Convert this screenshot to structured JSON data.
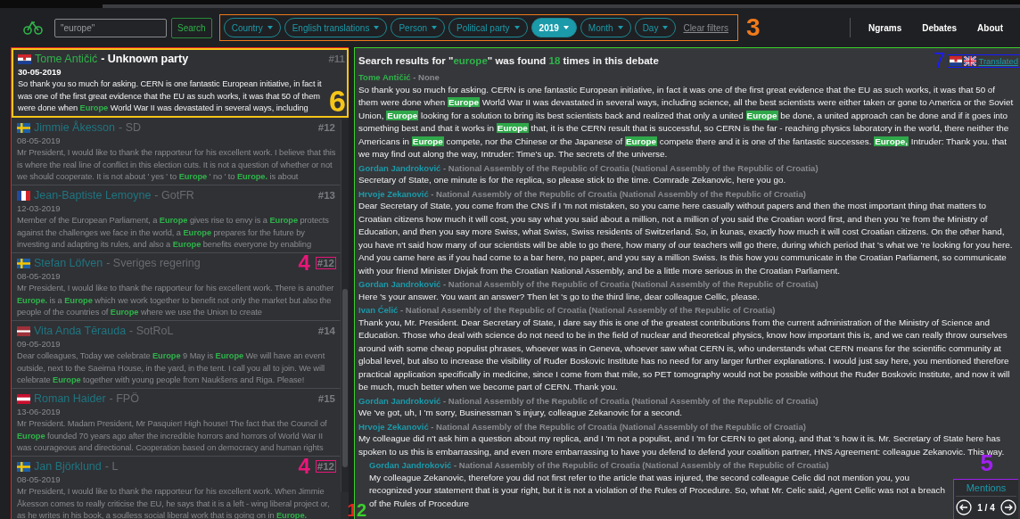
{
  "search": {
    "value": "\"europe\"",
    "button": "Search"
  },
  "filters": {
    "annotation": {
      "label": "3",
      "color": "#f07a1a"
    },
    "items": [
      {
        "label": "Country",
        "selected": false
      },
      {
        "label": "English translations",
        "selected": false
      },
      {
        "label": "Person",
        "selected": false
      },
      {
        "label": "Political party",
        "selected": false
      },
      {
        "label": "2019",
        "selected": true
      },
      {
        "label": "Month",
        "selected": false
      },
      {
        "label": "Day",
        "selected": false
      }
    ],
    "clear": "Clear filters"
  },
  "nav": [
    "Ngrams",
    "Debates",
    "About"
  ],
  "speeches": {
    "annotation": {
      "label": "1",
      "color": "#e8231f"
    },
    "items": [
      {
        "kind": "croatia",
        "name": "Tome Antičić",
        "color": "#2fb34a",
        "party": "- Unknown party",
        "number": "#11",
        "date": "30-05-2019",
        "selected": true,
        "annotation": {
          "label": "6",
          "color": "#f5c518"
        },
        "text": "So thank you so much for asking. CERN is one fantastic European initiative, in fact it was one of the first great evidence that the EU as such works, it was that 50 of them were done when **Europe** World War II was devastated in several ways, including"
      },
      {
        "kind": "sweden",
        "name": "Jimmie Åkesson",
        "color": "#1f7580",
        "party": "- SD",
        "number": "#12",
        "date": "08-05-2019",
        "selected": false,
        "text": "Mr President, I would like to thank the rapporteur for his excellent work. I believe that this is where the real line of conflict in this election cuts. It is not a question of whether or not we should cooperate. It is not about ' yes ' to **Europe** ' no ' to **Europe.** is about"
      },
      {
        "kind": "france",
        "name": "Jean-Baptiste Lemoyne",
        "color": "#1f7580",
        "party": "- GotFR",
        "number": "#13",
        "date": "12-03-2019",
        "selected": false,
        "text": "Member of the European Parliament, a **Europe** gives rise to envy is a **Europe** protects against the challenges we face in the world, a **Europe** prepares for the future by investing and adapting its rules, and also a **Europe** benefits everyone by enabling"
      },
      {
        "kind": "sweden",
        "name": "Stefan Löfven",
        "color": "#1f7580",
        "party": "- Sveriges regering",
        "number": "#12",
        "date": "08-05-2019",
        "selected": false,
        "annotation": {
          "label": "4",
          "color": "#e8177a"
        },
        "text": "Mr President, I would like to thank the rapporteur for his excellent work. There is another **Europe.** is a **Europe** which we work together to benefit not only the market but also the people of the countries of **Europe** where we use the Union to create"
      },
      {
        "kind": "latvia",
        "name": "Vita Anda Tērauda",
        "color": "#1f7580",
        "party": "- SotRoL",
        "number": "#14",
        "date": "09-05-2019",
        "selected": false,
        "text": "Dear colleagues, Today we celebrate **Europe** 9 May is **Europe** We will have an event outside, next to the Saeima House, in the yard, in the tent. I call you all to join. We will celebrate **Europe** together with young people from Naukšens and Riga. Please!"
      },
      {
        "kind": "austria",
        "name": "Roman Haider",
        "color": "#1f7580",
        "party": "- FPÖ",
        "number": "#15",
        "date": "13-06-2019",
        "selected": false,
        "text": "Mr President. Madam President, Mr Pasquier! High house! The fact that the Council of **Europe** founded 70 years ago after the incredible horrors and horrors of World War II was courageous and directional. Cooperation based on democracy and human rights"
      },
      {
        "kind": "sweden",
        "name": "Jan Björklund",
        "color": "#1f7580",
        "party": "- L",
        "number": "#12",
        "date": "08-05-2019",
        "selected": false,
        "annotation": {
          "label": "4",
          "color": "#e8177a"
        },
        "text": "Mr President, I would like to thank the rapporteur for his excellent work. When Jimmie Åkesson comes to really criticise the EU, he says that it is a left - wing liberal project or, as he writes in his book, a soulless social liberal work that is going on in **Europe.**"
      }
    ]
  },
  "debate": {
    "annotation": {
      "label": "2",
      "color": "#3bd12a"
    },
    "summary": {
      "prefix": "Search results for \"",
      "query": "europe",
      "middle": "\" was found ",
      "count": "18",
      "suffix": " times in this debate"
    },
    "translation": {
      "annotation": {
        "label": "7",
        "color": "#1a1aff"
      },
      "link": "Translated"
    },
    "entries": [
      {
        "name": "Tome Antičić",
        "color": "#2fb34a",
        "party": "- None",
        "text": "So thank you so much for asking. CERN is one fantastic European initiative, in fact it was one of the first great evidence that the EU as such works, it was that 50 of them were done when **Europe** World War II was devastated in several ways, including science, all the best scientists were either taken or gone to America or the Soviet Union, **Europe** looking for a solution to bring its best scientists back and realized that only a united **Europe** be done, a united approach can be done and if it goes into something best and that it works in **Europe** that, it is the CERN result that is successful, so CERN is the far - reaching physics laboratory in the world, there neither the Americans in **Europe** compete, nor the Chinese or the Japanese of **Europe** compete there and it is one of the fantastic successes. **Europe,** Intruder: Thank you. that we may find out along the way, Intruder: Time's up. The secrets of the universe."
      },
      {
        "name": "Gordan Jandroković",
        "color": "#1b9aaa",
        "party": "- National Assembly of the Republic of Croatia (National Assembly of the Republic of Croatia)",
        "text": "Secretary of State, one minute is for the replica, so please stick to the time. Comrade Zekanovic, here you go."
      },
      {
        "name": "Hrvoje Zekanović",
        "color": "#1b9aaa",
        "party": "- National Assembly of the Republic of Croatia (National Assembly of the Republic of Croatia)",
        "text": "Dear Secretary of State, you come from the CNS if I 'm not mistaken, so you came here casually without papers and then the most important thing that matters to Croatian citizens how much it will cost, you say what you said about a million, not a million of you said the Croatian word first, and then you 're from the Ministry of Education, and then you say more Swiss, what Swiss, Swiss residents of Switzerland. So, in kunas, exactly how much it will cost Croatian citizens. On the other hand, you have n't said how many of our scientists will be able to go there, how many of our teachers will go there, during which period that 's what we 're looking for you here. And you came here as if you had come to a bar here, no paper, and you say a million Swiss. Is this how you communicate in the Croatian Parliament, so communicate with your friend Minister Divjak from the Croatian National Assembly, and be a little more serious in the Croatian Parliament."
      },
      {
        "name": "Gordan Jandroković",
        "color": "#1b9aaa",
        "party": "- National Assembly of the Republic of Croatia (National Assembly of the Republic of Croatia)",
        "text": "Here 's your answer. You want an answer? Then let 's go to the third line, dear colleague Cellic, please."
      },
      {
        "name": "Ivan Ćelić",
        "color": "#1b9aaa",
        "party": "- National Assembly of the Republic of Croatia (National Assembly of the Republic of Croatia)",
        "text": "Thank you, Mr. President. Dear Secretary of State, I dare say this is one of the greatest contributions from the current administration of the Ministry of Science and Education. Those who deal with science do not need to be in the field of nuclear and theoretical physics, know how important this is, and we can really throw ourselves around with some cheap populist phrases, whoever was in Geneva, whoever saw what CERN is, who understands what CERN means for the scientific community at global level, but also to increase the visibility of Ruđer Boskovic Institute has no need for any larger further explanations. I would just say here, you mentioned therefore practical application specifically in medicine, since I come from that mile, so PET tomography would not be possible without the Ruđer Boskovic Institute, and now it will be much, much better when we become part of CERN. Thank you."
      },
      {
        "name": "Gordan Jandroković",
        "color": "#1b9aaa",
        "party": "- National Assembly of the Republic of Croatia (National Assembly of the Republic of Croatia)",
        "text": "We 've got, uh, I 'm sorry, Businessman 's injury, colleague Zekanovic for a second."
      },
      {
        "name": "Hrvoje Zekanović",
        "color": "#1b9aaa",
        "party": "- National Assembly of the Republic of Croatia (National Assembly of the Republic of Croatia)",
        "text": "My colleague did n't ask him a question about my replica, and I 'm not a populist, and I 'm for CERN to get along, and that 's how it is. Mr. Secretary of State here has spoken to us this is embarrassing, and even more embarrassing to have you defend to defend your coalition partner, HNS Agreement: colleague Zekanovic. This way."
      },
      {
        "name": "Gordan Jandroković",
        "color": "#1b9aaa",
        "party": "- National Assembly of the Republic of Croatia (National Assembly of the Republic of Croatia)",
        "text": "My colleague Zekanovic, therefore you did not first refer to the article that was injured, the second colleague Celic did not mention you, you recognized your statement that is your right, but it is not a violation of the Rules of Procedure. So, what Mr. Celic said, Agent Cellic was not a breach of the Rules of Procedure"
      }
    ],
    "mentions": {
      "annotation": {
        "label": "5",
        "color": "#a020f0"
      },
      "title": "Mentions",
      "page": "1 / 4"
    }
  }
}
